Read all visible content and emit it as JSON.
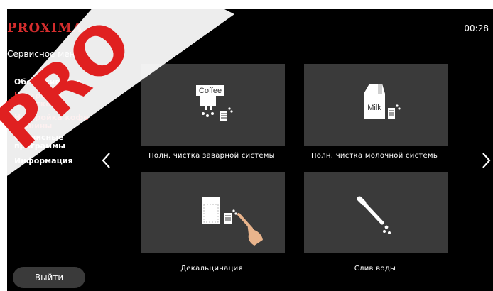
{
  "brand": "PROXIMA",
  "clock": "00:28",
  "menu_title": "Сервисное меню",
  "sidebar": {
    "items": [
      {
        "label": "Обслуживание"
      },
      {
        "label": "Настройка напитков"
      },
      {
        "label": "Настройка кофе машины"
      },
      {
        "label": "Сервисные программы"
      },
      {
        "label": "Информация"
      }
    ]
  },
  "tiles": [
    {
      "caption": "Полн. чистка заварной системы",
      "icon_text": "Coffee"
    },
    {
      "caption": "Полн. чистка молочной системы",
      "icon_text": "Milk"
    },
    {
      "caption": "Декальцинация"
    },
    {
      "caption": "Слив воды"
    }
  ],
  "exit_label": "Выйти",
  "watermark": "PRO",
  "colors": {
    "background": "#000000",
    "tile": "#3a3a3a",
    "accent_red": "#e03838",
    "text": "#ffffff"
  },
  "icons": [
    "chevron-left-icon",
    "chevron-right-icon",
    "coffee-cleaning-icon",
    "milk-cleaning-icon",
    "decalcination-icon",
    "water-drain-icon"
  ]
}
